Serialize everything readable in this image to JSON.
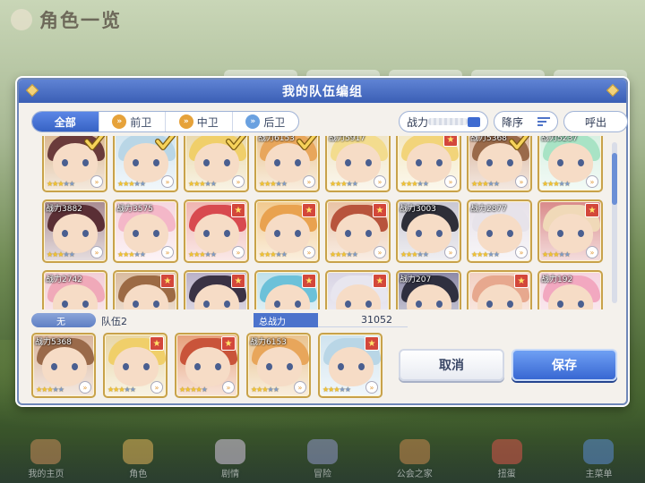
{
  "background": {
    "screen_title": "角色一览",
    "bottom_nav": [
      {
        "label": "我的主页",
        "icon": "home-icon"
      },
      {
        "label": "角色",
        "icon": "character-icon"
      },
      {
        "label": "剧情",
        "icon": "story-icon"
      },
      {
        "label": "冒险",
        "icon": "sword-icon"
      },
      {
        "label": "公会之家",
        "icon": "guild-house-icon"
      },
      {
        "label": "扭蛋",
        "icon": "gacha-icon"
      },
      {
        "label": "主菜单",
        "icon": "menu-icon"
      }
    ]
  },
  "modal": {
    "title": "我的队伍编组",
    "filters": {
      "all": "全部",
      "front": "前卫",
      "middle": "中卫",
      "back": "后卫"
    },
    "sort_field": "战力",
    "sort_order": "降序",
    "call_label": "呼出",
    "grid_cards": [
      {
        "power": "",
        "stars": 3,
        "fav": false,
        "selected": true,
        "hair": "#6a3b3b",
        "bg": "#d9b48c"
      },
      {
        "power": "",
        "stars": 3,
        "fav": false,
        "selected": true,
        "hair": "#b9d6e6",
        "bg": "#cfe3ef"
      },
      {
        "power": "",
        "stars": 3,
        "fav": false,
        "selected": true,
        "hair": "#f0cf6a",
        "bg": "#e8d6a6"
      },
      {
        "power": "战力6153",
        "stars": 3,
        "fav": false,
        "selected": true,
        "hair": "#e8a65b",
        "bg": "#e9c38f"
      },
      {
        "power": "战力5917",
        "stars": 3,
        "fav": false,
        "selected": false,
        "hair": "#f3dc8e",
        "bg": "#efe3c2"
      },
      {
        "power": "",
        "stars": 3,
        "fav": true,
        "selected": false,
        "hair": "#f2d47a",
        "bg": "#f3e7c1"
      },
      {
        "power": "战力5368",
        "stars": 3,
        "fav": false,
        "selected": true,
        "hair": "#9a6a4a",
        "bg": "#d8b39a"
      },
      {
        "power": "战力5237",
        "stars": 3,
        "fav": false,
        "selected": false,
        "hair": "#a8e3c5",
        "bg": "#d5efe0"
      },
      {
        "power": "战力3882",
        "stars": 3,
        "fav": false,
        "selected": false,
        "hair": "#5a2f35",
        "bg": "#a88b91"
      },
      {
        "power": "战力3575",
        "stars": 3,
        "fav": false,
        "selected": false,
        "hair": "#f4b7c8",
        "bg": "#f5d6df"
      },
      {
        "power": "",
        "stars": 3,
        "fav": true,
        "selected": false,
        "hair": "#d84a4f",
        "bg": "#efb4b0"
      },
      {
        "power": "",
        "stars": 3,
        "fav": true,
        "selected": false,
        "hair": "#e9a24f",
        "bg": "#f1c98e"
      },
      {
        "power": "",
        "stars": 3,
        "fav": true,
        "selected": false,
        "hair": "#b8543c",
        "bg": "#e9c3a5"
      },
      {
        "power": "战力3003",
        "stars": 3,
        "fav": false,
        "selected": false,
        "hair": "#2e2e38",
        "bg": "#c9c7d2"
      },
      {
        "power": "战力2877",
        "stars": 3,
        "fav": false,
        "selected": false,
        "hair": "#e7e3ea",
        "bg": "#e6e0e8"
      },
      {
        "power": "",
        "stars": 3,
        "fav": true,
        "selected": false,
        "hair": "#f0d9b8",
        "bg": "#d98a8a"
      },
      {
        "power": "战力2742",
        "stars": 3,
        "fav": false,
        "selected": false,
        "hair": "#f0a9b9",
        "bg": "#f2cdd6"
      },
      {
        "power": "",
        "stars": 3,
        "fav": true,
        "selected": false,
        "hair": "#9c6a44",
        "bg": "#d9bb9f"
      },
      {
        "power": "",
        "stars": 3,
        "fav": true,
        "selected": false,
        "hair": "#3a3244",
        "bg": "#b9b0c7"
      },
      {
        "power": "",
        "stars": 3,
        "fav": true,
        "selected": false,
        "hair": "#6cc1d9",
        "bg": "#bfe0ea"
      },
      {
        "power": "",
        "stars": 3,
        "fav": true,
        "selected": false,
        "hair": "#e8e6ef",
        "bg": "#d8d4e4"
      },
      {
        "power": "战力207",
        "stars": 3,
        "fav": false,
        "selected": false,
        "hair": "#2f2f3f",
        "bg": "#8b88a6"
      },
      {
        "power": "",
        "stars": 3,
        "fav": true,
        "selected": false,
        "hair": "#e7a88e",
        "bg": "#f2d0c2"
      },
      {
        "power": "战力192",
        "stars": 3,
        "fav": false,
        "selected": false,
        "hair": "#f2a8c0",
        "bg": "#f5d3df"
      }
    ],
    "party": {
      "slot_tag": "无",
      "name": "队伍2",
      "total_label": "总战力",
      "total_value": "31052",
      "members": [
        {
          "power": "战力5368",
          "stars": 3,
          "fav": false,
          "hair": "#9a6a4a",
          "bg": "#d8b39a"
        },
        {
          "power": "",
          "stars": 3,
          "fav": true,
          "hair": "#f0cf6a",
          "bg": "#e8d6a6"
        },
        {
          "power": "",
          "stars": 4,
          "fav": true,
          "hair": "#c9543a",
          "bg": "#e6a07a"
        },
        {
          "power": "战力6153",
          "stars": 3,
          "fav": false,
          "hair": "#e8a65b",
          "bg": "#e9c38f"
        },
        {
          "power": "",
          "stars": 3,
          "fav": true,
          "hair": "#b9d6e6",
          "bg": "#cfe3ef"
        }
      ]
    },
    "cancel_label": "取消",
    "save_label": "保存"
  },
  "colors": {
    "accent_blue": "#3b5fb5",
    "gold_frame": "#c8a24a",
    "fav_red": "#d3473b"
  }
}
